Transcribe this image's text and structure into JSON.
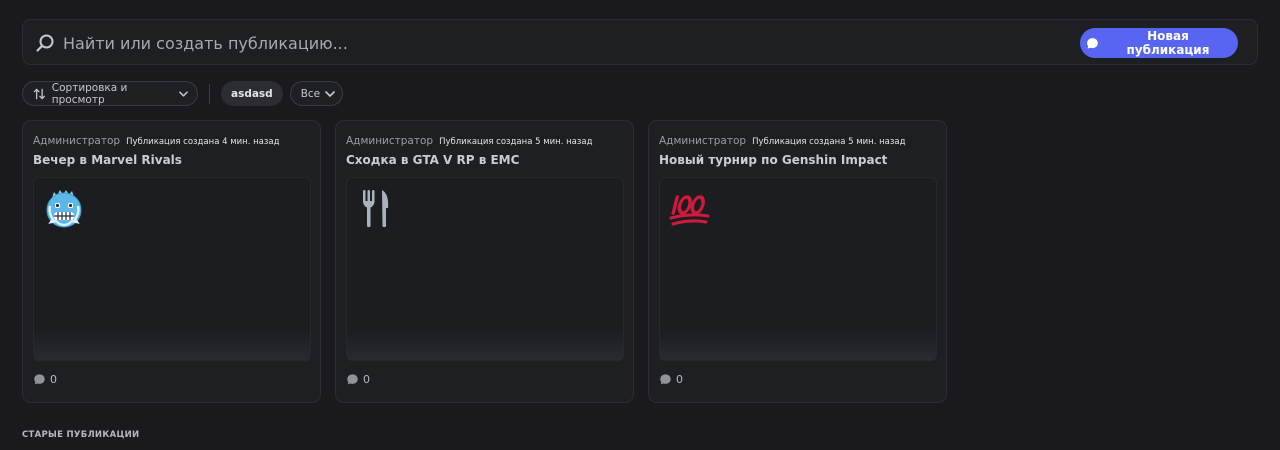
{
  "search": {
    "placeholder": "Найти или создать публикацию...",
    "value": ""
  },
  "toolbar": {
    "new_post_label": "Новая публикация",
    "sort_label": "Сортировка и просмотр",
    "tag_label": "asdasd",
    "filter_label": "Все"
  },
  "posts": [
    {
      "author": "Администратор",
      "time": "Публикация создана 4 мин. назад",
      "title": "Вечер в Marvel Rivals",
      "emoji_icon": "cold-face-icon",
      "comments": "0"
    },
    {
      "author": "Администратор",
      "time": "Публикация создана 5 мин. назад",
      "title": "Сходка в GTA V RP в EMC",
      "emoji_icon": "fork-and-knife-icon",
      "comments": "0"
    },
    {
      "author": "Администратор",
      "time": "Публикация создана 5 мин. назад",
      "title": "Новый турнир по Genshin Impact",
      "emoji_icon": "hundred-points-icon",
      "comments": "0"
    }
  ],
  "sections": {
    "older_heading": "СТАРЫЕ ПУБЛИКАЦИИ"
  },
  "colors": {
    "background": "#1a1a1e",
    "accent": "#5865f2",
    "card_background": "#1e1f23"
  }
}
